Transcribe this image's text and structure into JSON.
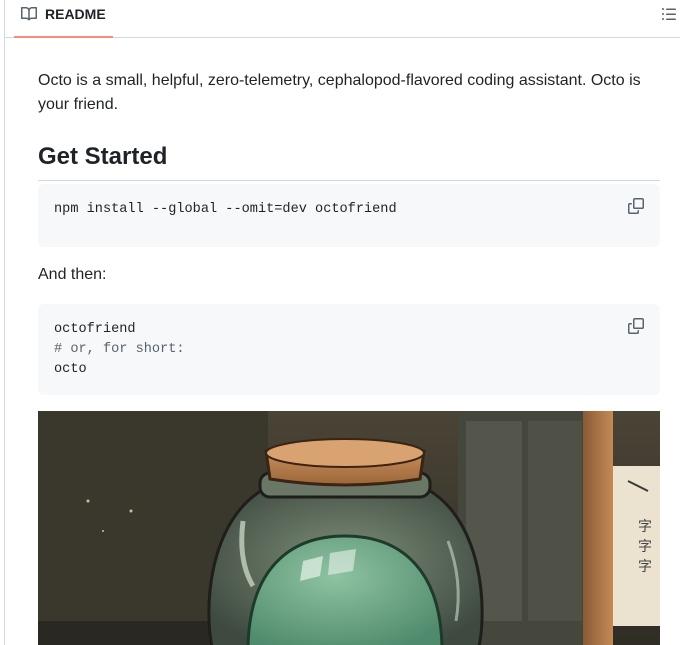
{
  "readme_tab": {
    "label": "README",
    "icon": "book-icon"
  },
  "outline_button": {
    "icon": "list-unordered-icon"
  },
  "intro": "Octo is a small, helpful, zero-telemetry, cephalopod-flavored coding assistant. Octo is your friend.",
  "get_started": {
    "heading": "Get Started",
    "install_cmd": "npm install --global --omit=dev octofriend",
    "and_then": "And then:",
    "run_lines": [
      {
        "text": "octofriend"
      },
      {
        "text": "# or, for short:"
      },
      {
        "text": "octo"
      }
    ]
  },
  "colors": {
    "tab_underline": "#fd8c73",
    "code_bg": "#f6f8fa",
    "border": "#d1d9e0",
    "comment": "#59636e"
  },
  "image": {
    "subject": "glass jar with cork lid containing a green octopus"
  }
}
